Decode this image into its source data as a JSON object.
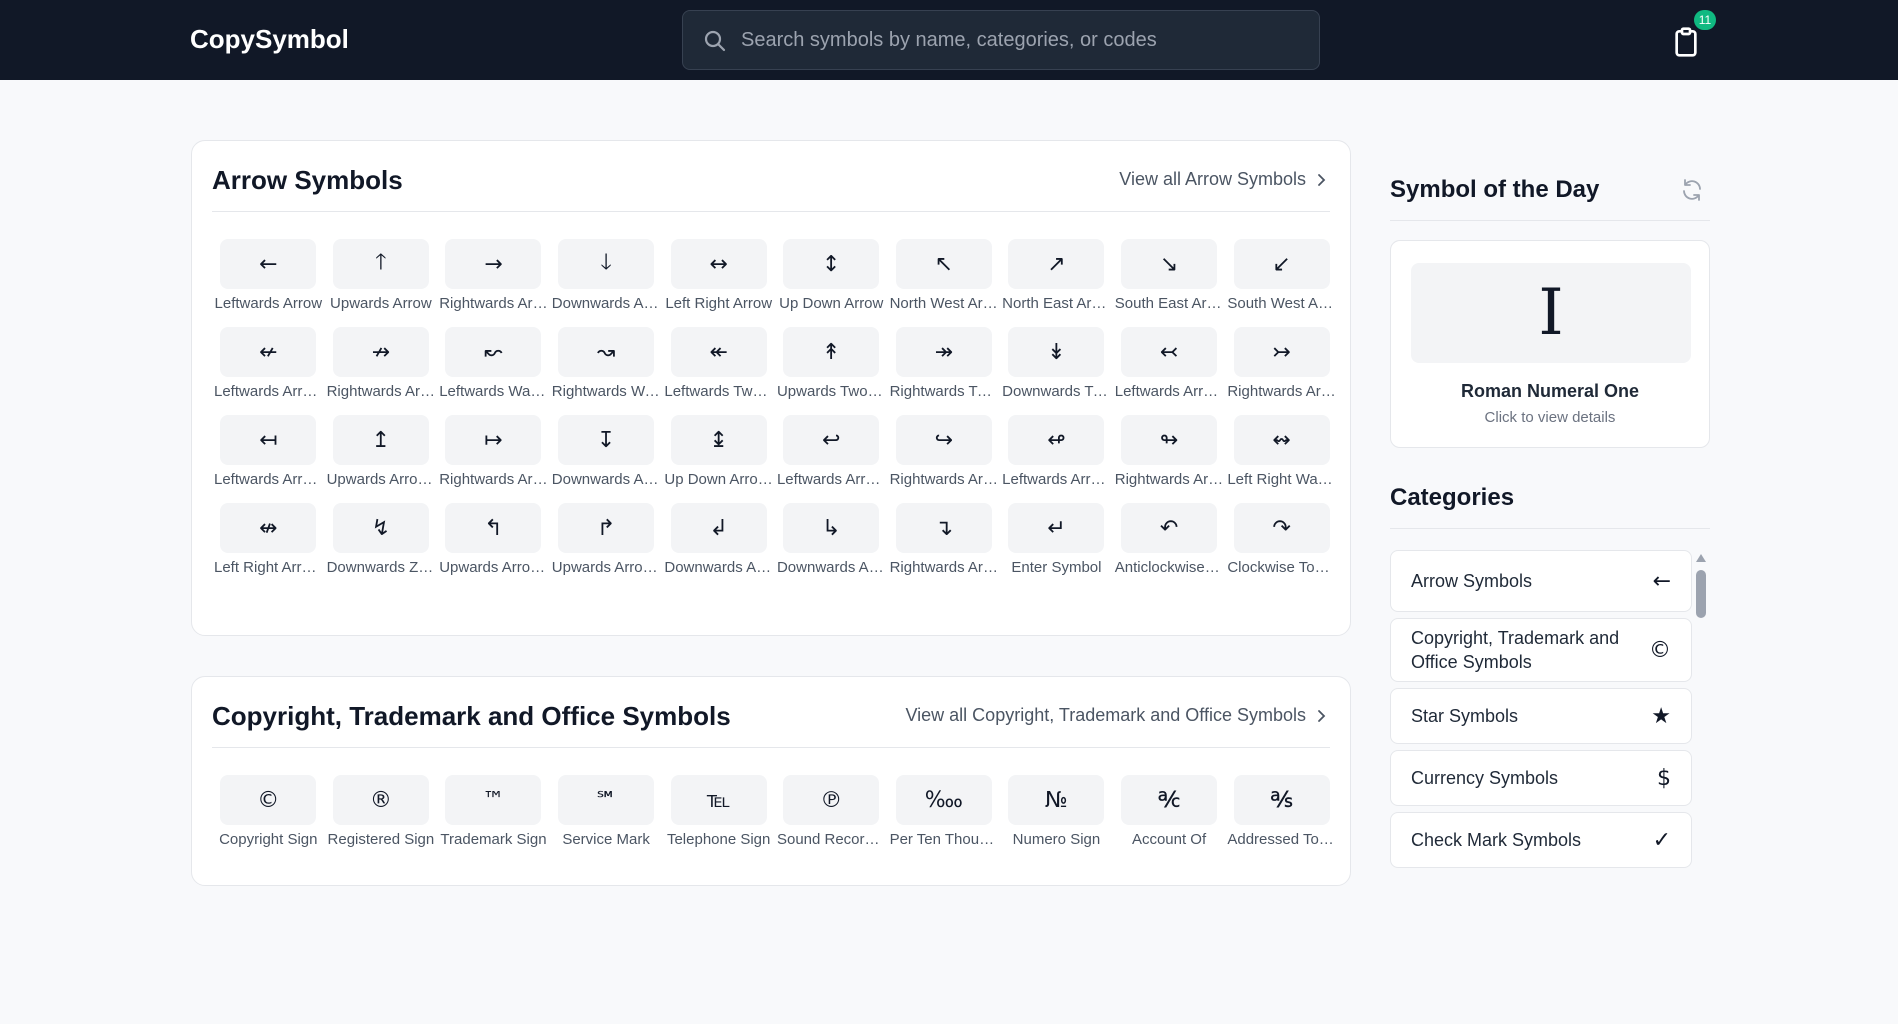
{
  "header": {
    "logo": "CopySymbol",
    "search_placeholder": "Search symbols by name, categories, or codes",
    "clipboard_count": "11"
  },
  "sections": [
    {
      "title": "Arrow Symbols",
      "view_all": "View all Arrow Symbols",
      "items": [
        {
          "symbol": "←",
          "label": "Leftwards Arrow"
        },
        {
          "symbol": "🡑",
          "label": "Upwards Arrow"
        },
        {
          "symbol": "→",
          "label": "Rightwards Arrow"
        },
        {
          "symbol": "🡓",
          "label": "Downwards Arrow"
        },
        {
          "symbol": "↔",
          "label": "Left Right Arrow"
        },
        {
          "symbol": "↕",
          "label": "Up Down Arrow"
        },
        {
          "symbol": "↖",
          "label": "North West Arrow"
        },
        {
          "symbol": "↗",
          "label": "North East Arrow"
        },
        {
          "symbol": "↘",
          "label": "South East Arrow"
        },
        {
          "symbol": "↙",
          "label": "South West Arrow"
        },
        {
          "symbol": "↚",
          "label": "Leftwards Arrow with Stroke"
        },
        {
          "symbol": "↛",
          "label": "Rightwards Arrow with Stroke"
        },
        {
          "symbol": "↜",
          "label": "Leftwards Wave Arrow"
        },
        {
          "symbol": "↝",
          "label": "Rightwards Wave Arrow"
        },
        {
          "symbol": "↞",
          "label": "Leftwards Two Headed Arrow"
        },
        {
          "symbol": "↟",
          "label": "Upwards Two Headed Arrow"
        },
        {
          "symbol": "↠",
          "label": "Rightwards Two Headed Arrow"
        },
        {
          "symbol": "↡",
          "label": "Downwards Two Headed Arrow"
        },
        {
          "symbol": "↢",
          "label": "Leftwards Arrow with Tail"
        },
        {
          "symbol": "↣",
          "label": "Rightwards Arrow with Tail"
        },
        {
          "symbol": "↤",
          "label": "Leftwards Arrow from Bar"
        },
        {
          "symbol": "↥",
          "label": "Upwards Arrow from Bar"
        },
        {
          "symbol": "↦",
          "label": "Rightwards Arrow from Bar"
        },
        {
          "symbol": "↧",
          "label": "Downwards Arrow from Bar"
        },
        {
          "symbol": "↨",
          "label": "Up Down Arrow with Base"
        },
        {
          "symbol": "↩",
          "label": "Leftwards Arrow with Hook"
        },
        {
          "symbol": "↪",
          "label": "Rightwards Arrow with Hook"
        },
        {
          "symbol": "↫",
          "label": "Leftwards Arrow with Loop"
        },
        {
          "symbol": "↬",
          "label": "Rightwards Arrow with Loop"
        },
        {
          "symbol": "↭",
          "label": "Left Right Wave Arrow"
        },
        {
          "symbol": "↮",
          "label": "Left Right Arrow with Stroke"
        },
        {
          "symbol": "↯",
          "label": "Downwards Zigzag Arrow"
        },
        {
          "symbol": "↰",
          "label": "Upwards Arrow with Tip Leftwards"
        },
        {
          "symbol": "↱",
          "label": "Upwards Arrow with Tip Rightwards"
        },
        {
          "symbol": "↲",
          "label": "Downwards Arrow with Tip Leftwards"
        },
        {
          "symbol": "↳",
          "label": "Downwards Arrow with Tip Rightwards"
        },
        {
          "symbol": "↴",
          "label": "Rightwards Arrow with Corner Downwards"
        },
        {
          "symbol": "↵",
          "label": "Enter Symbol"
        },
        {
          "symbol": "↶",
          "label": "Anticlockwise Top Semicircle Arrow"
        },
        {
          "symbol": "↷",
          "label": "Clockwise Top Semicircle Arrow"
        }
      ]
    },
    {
      "title": "Copyright, Trademark and Office Symbols",
      "view_all": "View all Copyright, Trademark and Office Symbols",
      "items": [
        {
          "symbol": "©",
          "label": "Copyright Sign"
        },
        {
          "symbol": "®",
          "label": "Registered Sign"
        },
        {
          "symbol": "™",
          "label": "Trademark Sign"
        },
        {
          "symbol": "℠",
          "label": "Service Mark"
        },
        {
          "symbol": "℡",
          "label": "Telephone Sign"
        },
        {
          "symbol": "℗",
          "label": "Sound Recording Copyright"
        },
        {
          "symbol": "‱",
          "label": "Per Ten Thousand Sign"
        },
        {
          "symbol": "№",
          "label": "Numero Sign"
        },
        {
          "symbol": "℀",
          "label": "Account Of"
        },
        {
          "symbol": "℁",
          "label": "Addressed To The Subject"
        }
      ]
    }
  ],
  "sidebar": {
    "symbol_of_day_title": "Symbol of the Day",
    "symbol_of_day": {
      "symbol": "I",
      "name": "Roman Numeral One",
      "hint": "Click to view details"
    },
    "categories_title": "Categories",
    "categories": [
      {
        "label": "Arrow Symbols",
        "icon": "←"
      },
      {
        "label": "Copyright, Trademark and Office Symbols",
        "icon": "©"
      },
      {
        "label": "Star Symbols",
        "icon": "★"
      },
      {
        "label": "Currency Symbols",
        "icon": "$"
      },
      {
        "label": "Check Mark Symbols",
        "icon": "✓"
      }
    ]
  }
}
